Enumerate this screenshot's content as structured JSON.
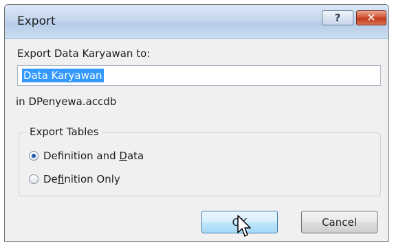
{
  "dialog": {
    "title": "Export",
    "help_glyph": "?",
    "close_glyph": "✕"
  },
  "export": {
    "prompt_label": "Export Data Karyawan to:",
    "name_value": "Data Karyawan",
    "location_text": "in DPenyewa.accdb"
  },
  "export_tables": {
    "legend": "Export Tables",
    "options": [
      {
        "pre": "Definition and ",
        "mnemonic": "D",
        "post": "ata",
        "checked": true
      },
      {
        "pre": "De",
        "mnemonic": "f",
        "post": "inition Only",
        "checked": false
      }
    ]
  },
  "buttons": {
    "ok_label": "OK",
    "cancel_label": "Cancel"
  },
  "colors": {
    "close_button": "#c23a1d",
    "selection": "#3399ff",
    "ok_border": "#3c7fb1"
  },
  "icons": {
    "help": "help-icon",
    "close": "close-icon",
    "cursor": "mouse-pointer-icon"
  }
}
